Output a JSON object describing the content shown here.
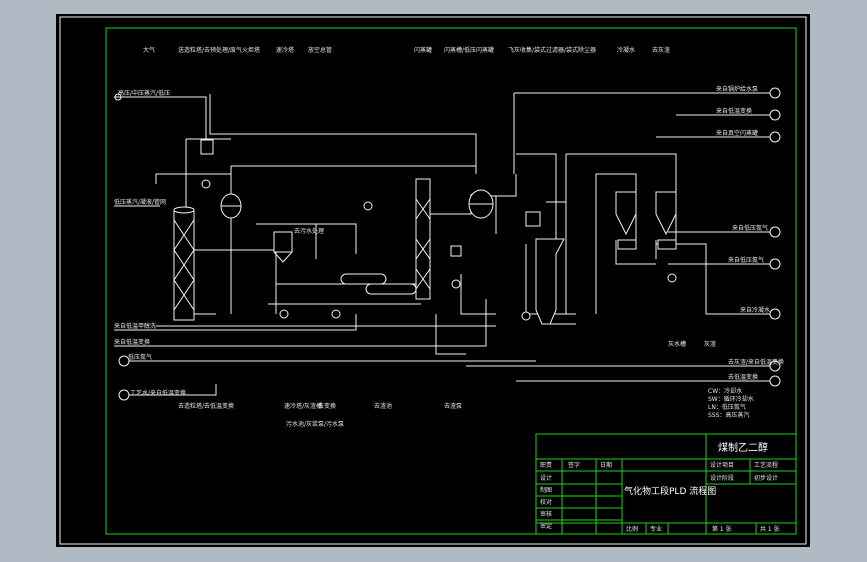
{
  "colors": {
    "frame": "#19d219",
    "lines": "#f2f2f2",
    "background": "#000000",
    "outer": "#afbac5"
  },
  "top_labels": [
    "大气",
    "送造粒塔/去预处理/废气火炬塔",
    "速冷塔",
    "放空总管",
    "闪蒸罐",
    "闪蒸槽/低压闪蒸罐",
    "飞灰收集/袋式过滤器/袋式除尘器",
    "冷凝水",
    "去灰渣"
  ],
  "left_labels": [
    "高压/中压蒸汽/低压",
    "低压蒸汽/凝液/管网",
    "来自低温甲醇洗",
    "来自低温变换",
    "低压氮气",
    "工艺水/来自低温变换"
  ],
  "right_labels": [
    "来自锅炉给水泵",
    "来自低温变换",
    "来自真空闪蒸罐",
    "来自低压氮气",
    "来自低压氮气",
    "来自冷凝水",
    "去灰渣/来自低温变换",
    "去低温变换"
  ],
  "middle_labels": [
    "去污水处理",
    "灰水槽",
    "灰渣",
    "去渣池"
  ],
  "bottom_labels": [
    "去造粒塔/去低温变换",
    "速冷塔/灰渣槽",
    "去变换",
    "去渣泵",
    "污水池/灰浆泵/污水泵"
  ],
  "legend": [
    "CW：冷却水",
    "SW：循环冷却水",
    "LN：低压氮气",
    "SSS：高压蒸汽"
  ],
  "title_block": {
    "project": "煤制乙二醇",
    "row_labels": [
      "设计",
      "制图",
      "校对",
      "审核",
      "审定"
    ],
    "col_labels": [
      "职责",
      "签字",
      "日期"
    ],
    "drawing_title": "气化物工段PLD 流程图",
    "design_item_label": "设计项目",
    "design_item_value": "工艺流程",
    "design_stage_label": "设计阶段",
    "design_stage_value": "初步设计",
    "scale_label": "比例",
    "discipline_label": "专业",
    "sheet_label": "第 1 张",
    "total_label": "共 1 张"
  }
}
